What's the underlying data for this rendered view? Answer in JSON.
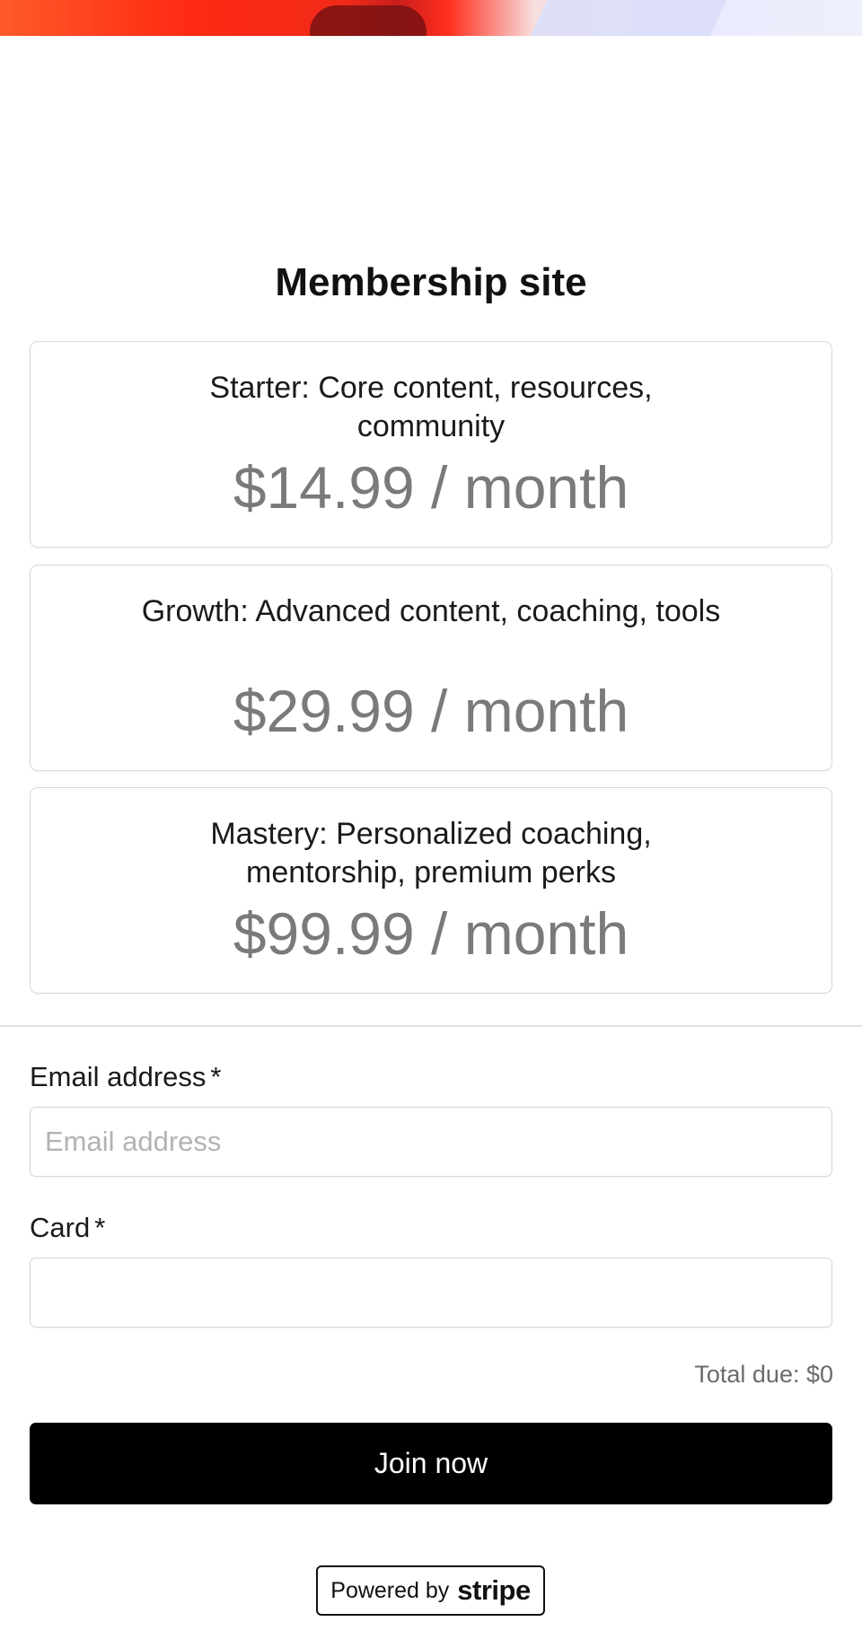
{
  "page": {
    "title": "Membership site"
  },
  "plans": [
    {
      "name": "Starter: Core content, resources, community",
      "price": "$14.99 / month"
    },
    {
      "name": "Growth: Advanced content, coaching, tools",
      "price": "$29.99 / month"
    },
    {
      "name": "Mastery: Personalized coaching, mentorship, premium perks",
      "price": "$99.99 / month"
    }
  ],
  "form": {
    "email_label": "Email address",
    "email_placeholder": "Email address",
    "email_value": "",
    "card_label": "Card",
    "card_value": "",
    "required_marker": "*",
    "total": "Total due: $0",
    "submit_label": "Join now"
  },
  "footer": {
    "powered_by": "Powered by",
    "brand": "stripe"
  },
  "colors": {
    "button_bg": "#000000",
    "price_text": "#7a7a7a",
    "hero_accent": "#ff2a12"
  }
}
